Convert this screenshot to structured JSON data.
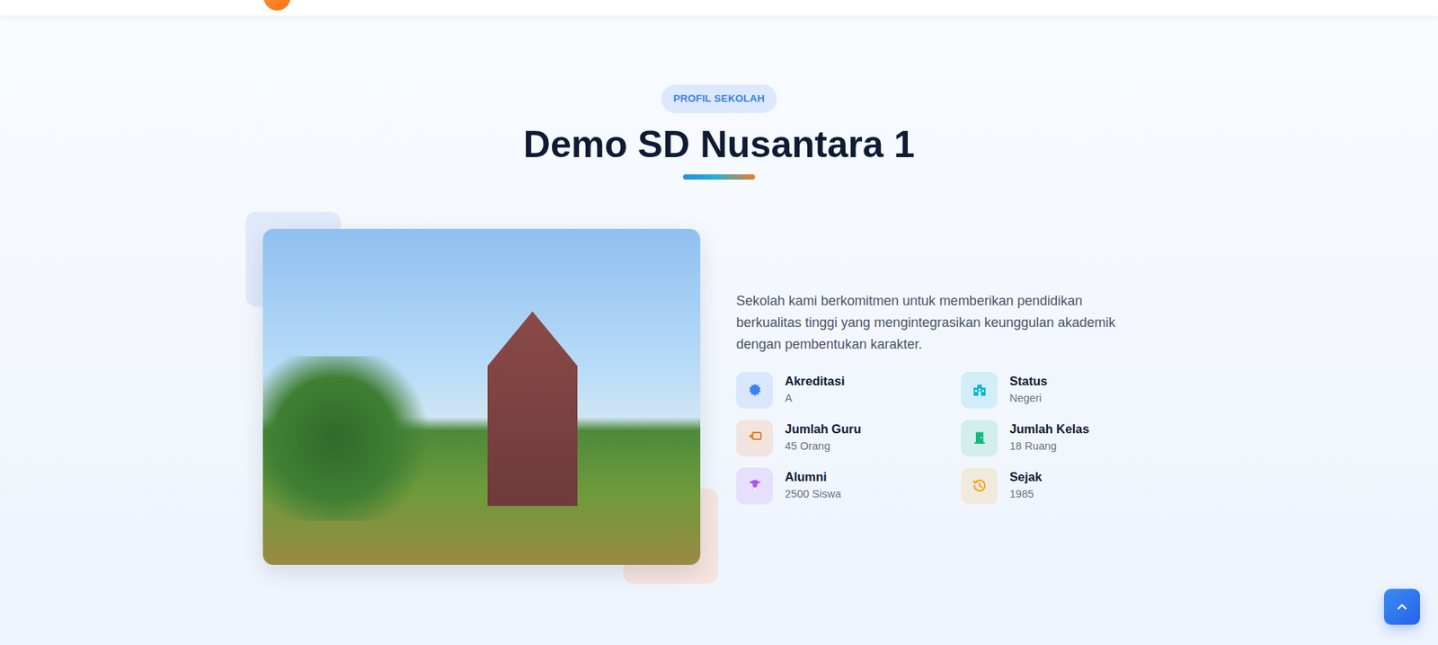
{
  "section": {
    "badge": "PROFIL SEKOLAH",
    "title": "Demo SD Nusantara 1",
    "description": "Sekolah kami berkomitmen untuk memberikan pendidikan berkualitas tinggi yang mengintegrasikan keunggulan akademik dengan pembentukan karakter."
  },
  "facts": [
    {
      "label": "Akreditasi",
      "value": "A",
      "color": "#3b82f6"
    },
    {
      "label": "Status",
      "value": "Negeri",
      "color": "#06b6d4"
    },
    {
      "label": "Jumlah Guru",
      "value": "45 Orang",
      "color": "#f97316"
    },
    {
      "label": "Jumlah Kelas",
      "value": "18 Ruang",
      "color": "#10b981"
    },
    {
      "label": "Alumni",
      "value": "2500 Siswa",
      "color": "#a855f7"
    },
    {
      "label": "Sejak",
      "value": "1985",
      "color": "#f59e0b"
    }
  ]
}
